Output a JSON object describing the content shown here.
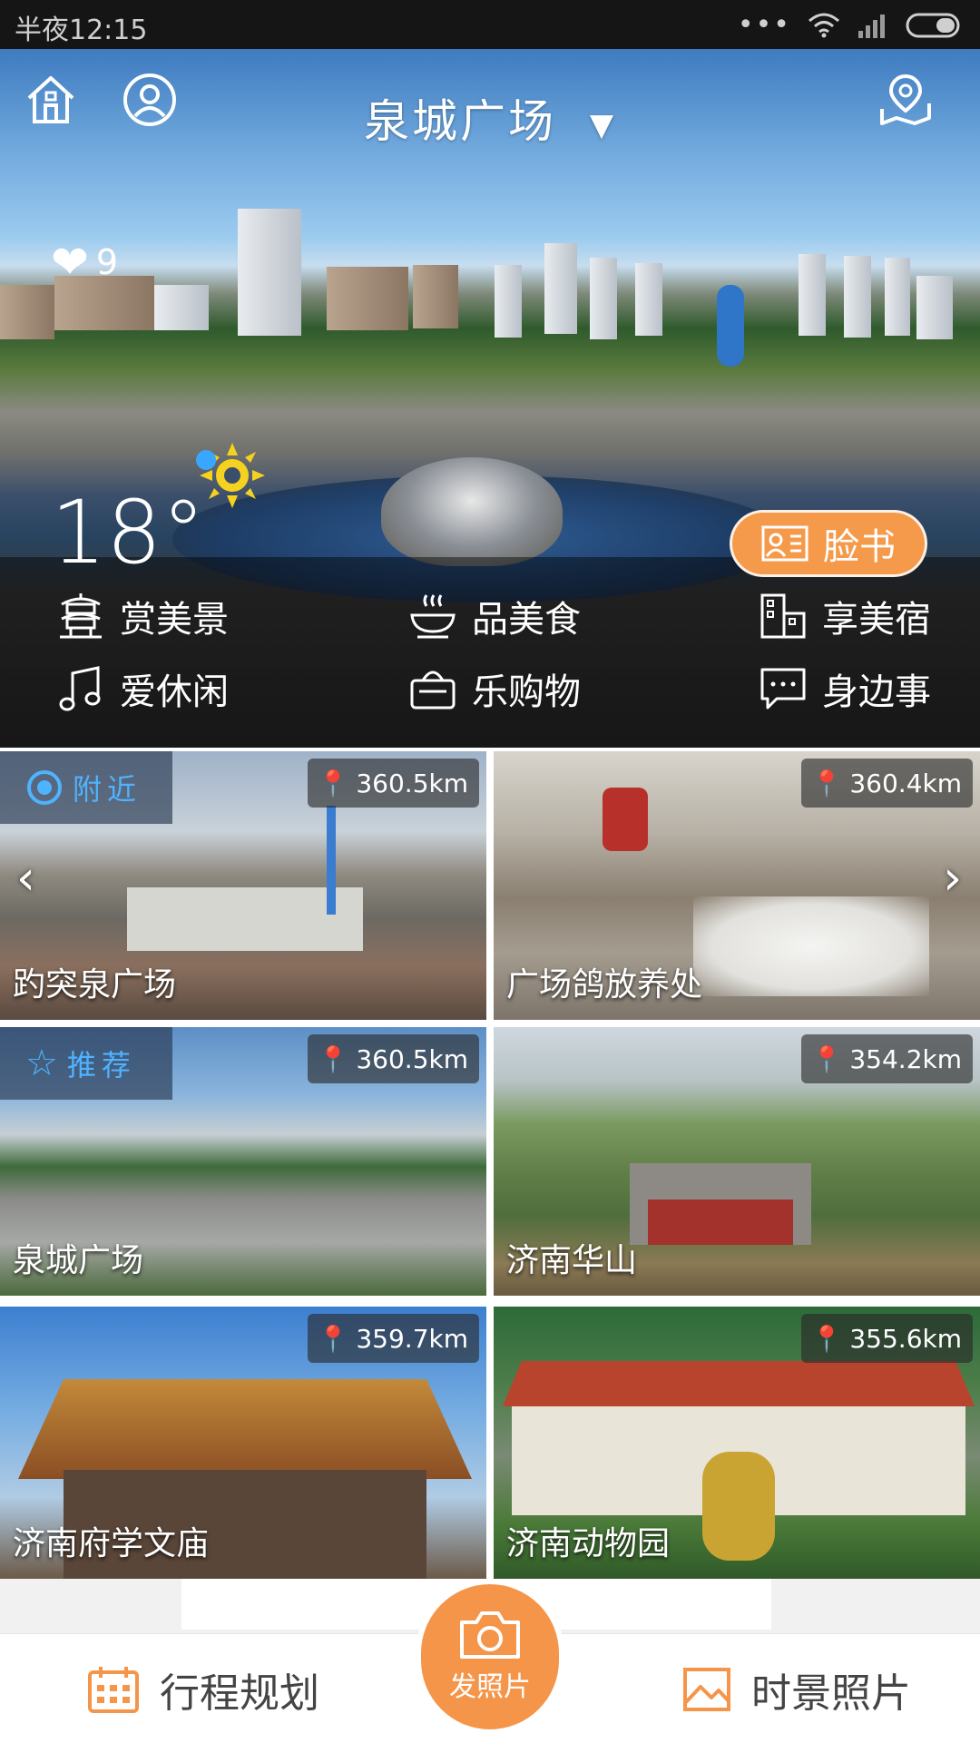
{
  "status_bar": {
    "time": "半夜12:15"
  },
  "header": {
    "title": "泉城广场",
    "likes": "9"
  },
  "weather": {
    "temperature": "18°"
  },
  "facebook_label": "脸书",
  "categories": [
    {
      "label": "赏美景",
      "icon": "pagoda-icon"
    },
    {
      "label": "品美食",
      "icon": "food-bowl-icon"
    },
    {
      "label": "享美宿",
      "icon": "building-icon"
    },
    {
      "label": "爱休闲",
      "icon": "music-note-icon"
    },
    {
      "label": "乐购物",
      "icon": "shopping-basket-icon"
    },
    {
      "label": "身边事",
      "icon": "chat-bubble-icon"
    }
  ],
  "places": [
    {
      "name": "趵突泉广场",
      "distance": "360.5km",
      "tag": "附近"
    },
    {
      "name": "广场鸽放养处",
      "distance": "360.4km"
    },
    {
      "name": "泉城广场",
      "distance": "360.5km",
      "tag": "推荐"
    },
    {
      "name": "济南华山",
      "distance": "354.2km"
    },
    {
      "name": "济南府学文庙",
      "distance": "359.7km"
    },
    {
      "name": "济南动物园",
      "distance": "355.6km"
    }
  ],
  "bottom_nav": {
    "left_label": "行程规划",
    "center_label": "发照片",
    "right_label": "时景照片"
  },
  "colors": {
    "accent": "#f5954a",
    "tag_blue": "#4fb3ff"
  }
}
